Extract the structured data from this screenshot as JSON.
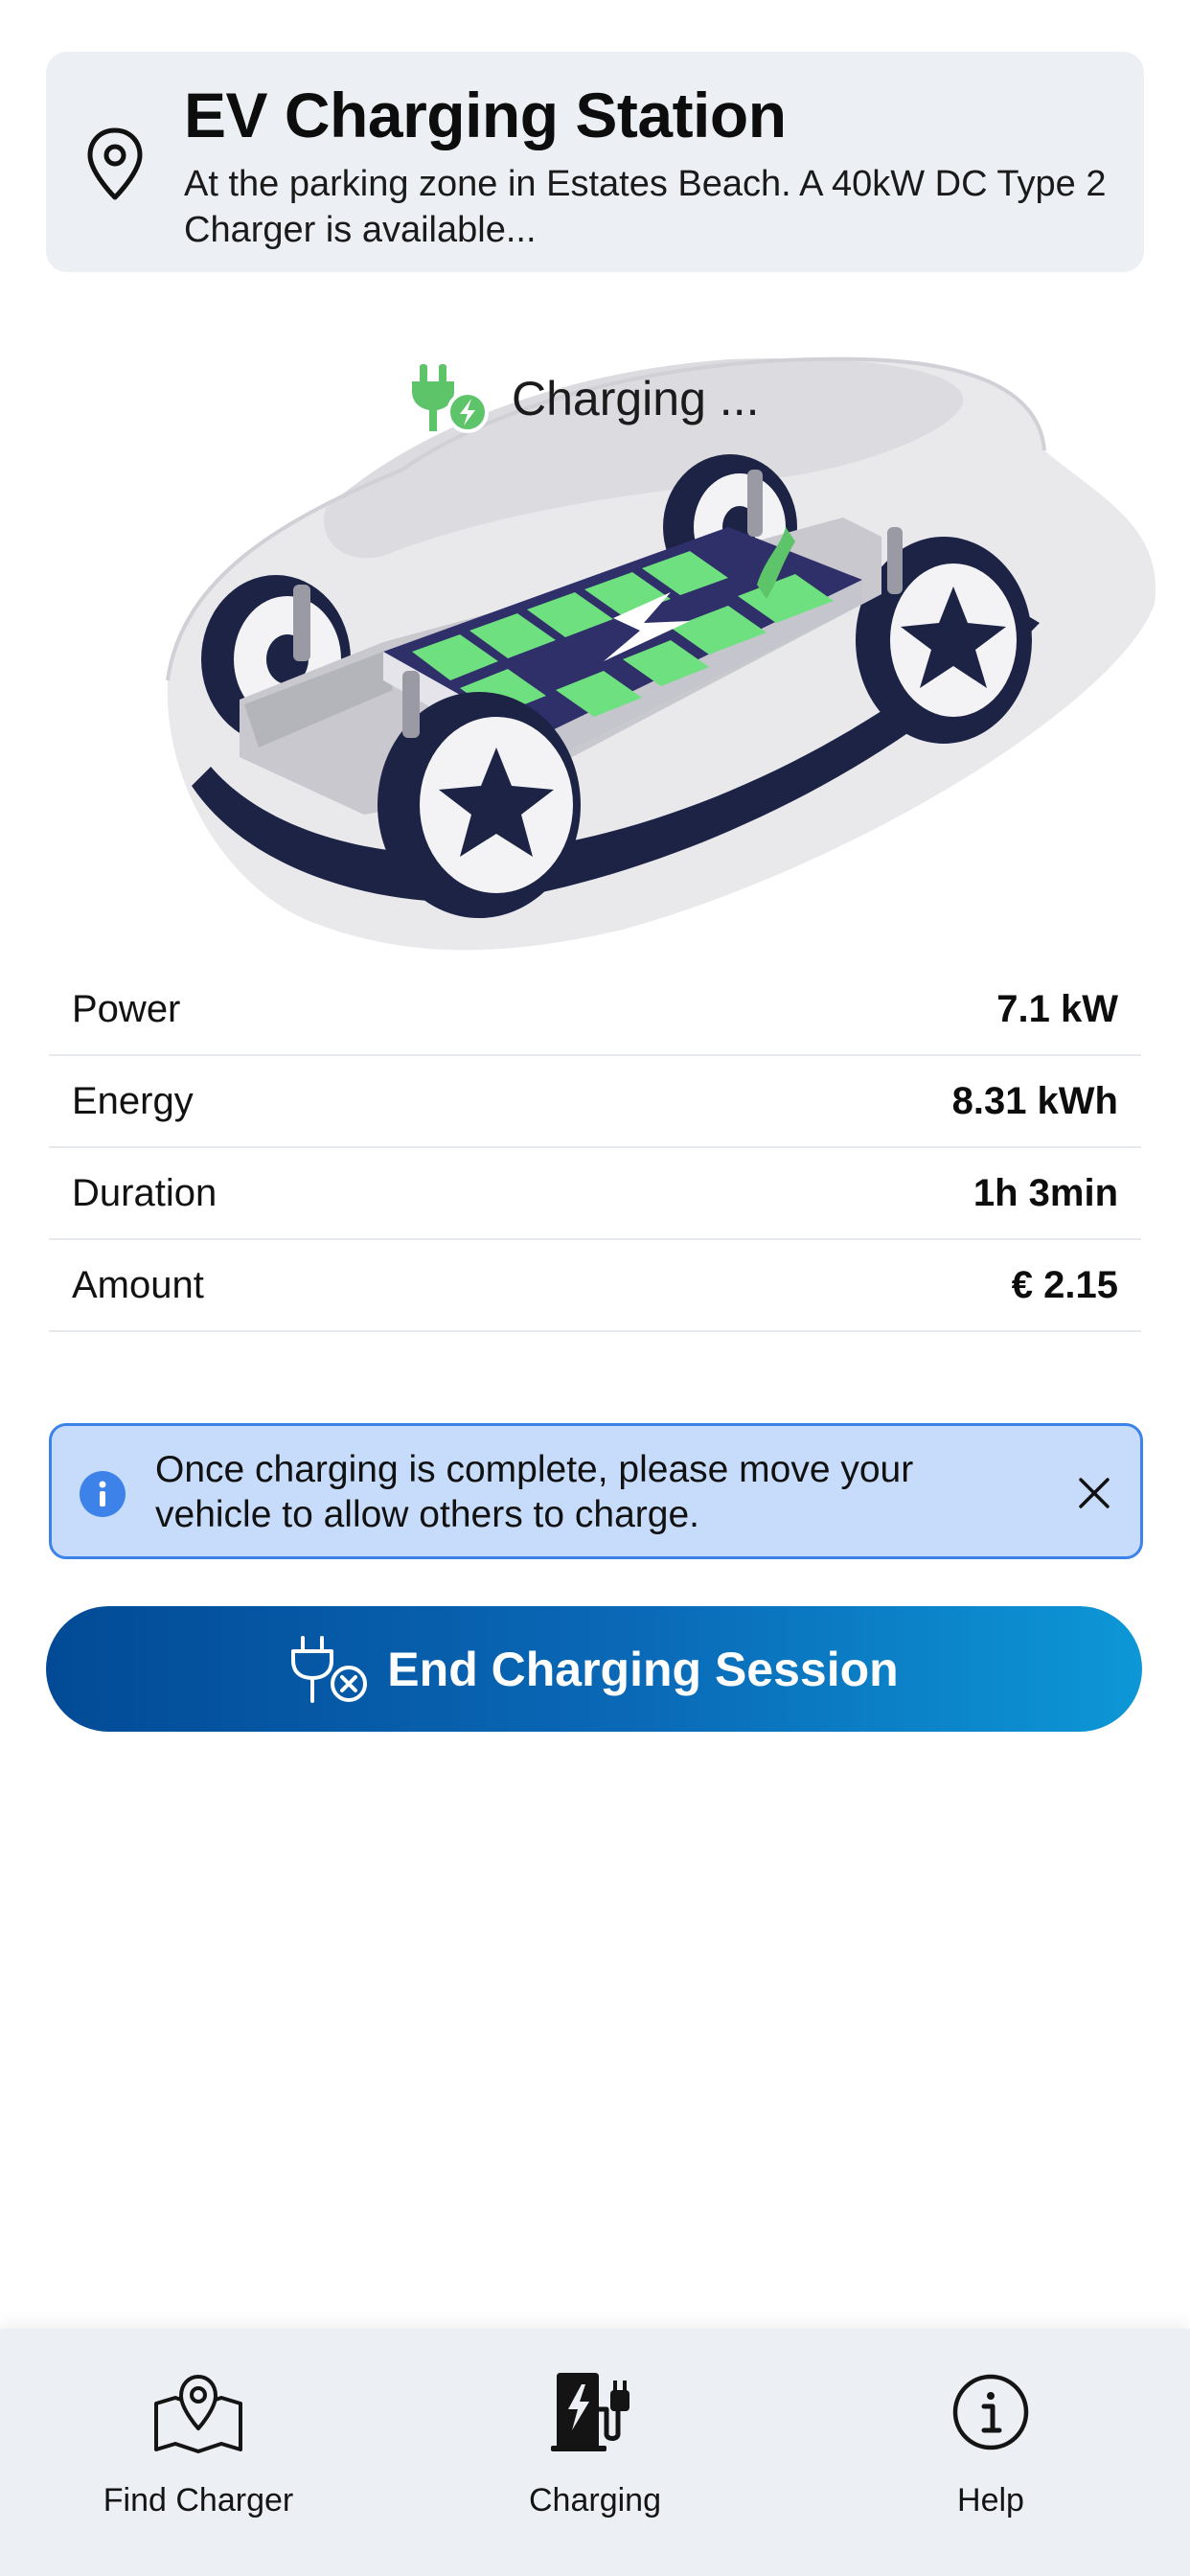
{
  "station": {
    "title": "EV Charging Station",
    "description": "At the parking zone in Estates Beach. A 40kW DC Type 2 Charger is available..."
  },
  "status": {
    "label": "Charging ...",
    "color": "#5ec46a"
  },
  "stats": [
    {
      "label": "Power",
      "value": "7.1 kW"
    },
    {
      "label": "Energy",
      "value": "8.31 kWh"
    },
    {
      "label": "Duration",
      "value": "1h 3min"
    },
    {
      "label": "Amount",
      "value": "€ 2.15"
    }
  ],
  "notice": {
    "text": "Once charging is complete, please move your vehicle to allow others to charge.",
    "icon": "info-icon",
    "accent": "#3c82e8"
  },
  "action": {
    "label": "End Charging Session",
    "icon": "plug-cancel-icon"
  },
  "nav": {
    "items": [
      {
        "label": "Find Charger",
        "icon": "map-pin-icon"
      },
      {
        "label": "Charging",
        "icon": "charging-station-icon",
        "active": true
      },
      {
        "label": "Help",
        "icon": "info-circle-icon"
      }
    ]
  }
}
